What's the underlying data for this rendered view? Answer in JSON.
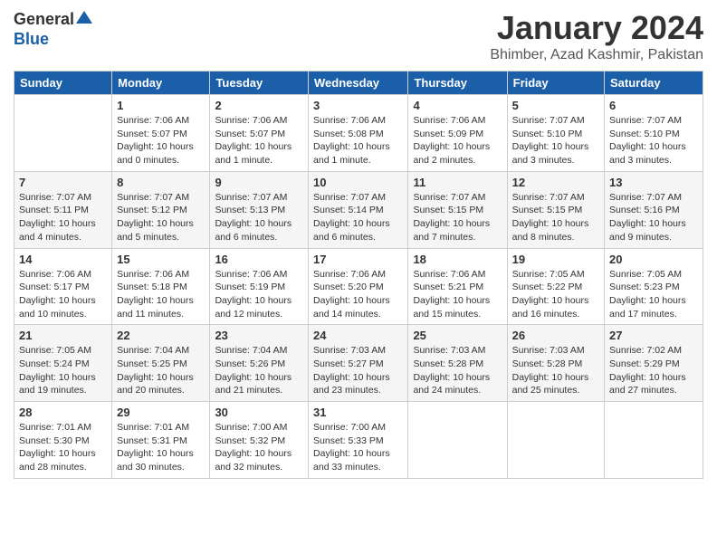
{
  "logo": {
    "general": "General",
    "blue": "Blue"
  },
  "header": {
    "month": "January 2024",
    "location": "Bhimber, Azad Kashmir, Pakistan"
  },
  "weekdays": [
    "Sunday",
    "Monday",
    "Tuesday",
    "Wednesday",
    "Thursday",
    "Friday",
    "Saturday"
  ],
  "weeks": [
    [
      {
        "day": "",
        "sunrise": "",
        "sunset": "",
        "daylight": ""
      },
      {
        "day": "1",
        "sunrise": "Sunrise: 7:06 AM",
        "sunset": "Sunset: 5:07 PM",
        "daylight": "Daylight: 10 hours and 0 minutes."
      },
      {
        "day": "2",
        "sunrise": "Sunrise: 7:06 AM",
        "sunset": "Sunset: 5:07 PM",
        "daylight": "Daylight: 10 hours and 1 minute."
      },
      {
        "day": "3",
        "sunrise": "Sunrise: 7:06 AM",
        "sunset": "Sunset: 5:08 PM",
        "daylight": "Daylight: 10 hours and 1 minute."
      },
      {
        "day": "4",
        "sunrise": "Sunrise: 7:06 AM",
        "sunset": "Sunset: 5:09 PM",
        "daylight": "Daylight: 10 hours and 2 minutes."
      },
      {
        "day": "5",
        "sunrise": "Sunrise: 7:07 AM",
        "sunset": "Sunset: 5:10 PM",
        "daylight": "Daylight: 10 hours and 3 minutes."
      },
      {
        "day": "6",
        "sunrise": "Sunrise: 7:07 AM",
        "sunset": "Sunset: 5:10 PM",
        "daylight": "Daylight: 10 hours and 3 minutes."
      }
    ],
    [
      {
        "day": "7",
        "sunrise": "Sunrise: 7:07 AM",
        "sunset": "Sunset: 5:11 PM",
        "daylight": "Daylight: 10 hours and 4 minutes."
      },
      {
        "day": "8",
        "sunrise": "Sunrise: 7:07 AM",
        "sunset": "Sunset: 5:12 PM",
        "daylight": "Daylight: 10 hours and 5 minutes."
      },
      {
        "day": "9",
        "sunrise": "Sunrise: 7:07 AM",
        "sunset": "Sunset: 5:13 PM",
        "daylight": "Daylight: 10 hours and 6 minutes."
      },
      {
        "day": "10",
        "sunrise": "Sunrise: 7:07 AM",
        "sunset": "Sunset: 5:14 PM",
        "daylight": "Daylight: 10 hours and 6 minutes."
      },
      {
        "day": "11",
        "sunrise": "Sunrise: 7:07 AM",
        "sunset": "Sunset: 5:15 PM",
        "daylight": "Daylight: 10 hours and 7 minutes."
      },
      {
        "day": "12",
        "sunrise": "Sunrise: 7:07 AM",
        "sunset": "Sunset: 5:15 PM",
        "daylight": "Daylight: 10 hours and 8 minutes."
      },
      {
        "day": "13",
        "sunrise": "Sunrise: 7:07 AM",
        "sunset": "Sunset: 5:16 PM",
        "daylight": "Daylight: 10 hours and 9 minutes."
      }
    ],
    [
      {
        "day": "14",
        "sunrise": "Sunrise: 7:06 AM",
        "sunset": "Sunset: 5:17 PM",
        "daylight": "Daylight: 10 hours and 10 minutes."
      },
      {
        "day": "15",
        "sunrise": "Sunrise: 7:06 AM",
        "sunset": "Sunset: 5:18 PM",
        "daylight": "Daylight: 10 hours and 11 minutes."
      },
      {
        "day": "16",
        "sunrise": "Sunrise: 7:06 AM",
        "sunset": "Sunset: 5:19 PM",
        "daylight": "Daylight: 10 hours and 12 minutes."
      },
      {
        "day": "17",
        "sunrise": "Sunrise: 7:06 AM",
        "sunset": "Sunset: 5:20 PM",
        "daylight": "Daylight: 10 hours and 14 minutes."
      },
      {
        "day": "18",
        "sunrise": "Sunrise: 7:06 AM",
        "sunset": "Sunset: 5:21 PM",
        "daylight": "Daylight: 10 hours and 15 minutes."
      },
      {
        "day": "19",
        "sunrise": "Sunrise: 7:05 AM",
        "sunset": "Sunset: 5:22 PM",
        "daylight": "Daylight: 10 hours and 16 minutes."
      },
      {
        "day": "20",
        "sunrise": "Sunrise: 7:05 AM",
        "sunset": "Sunset: 5:23 PM",
        "daylight": "Daylight: 10 hours and 17 minutes."
      }
    ],
    [
      {
        "day": "21",
        "sunrise": "Sunrise: 7:05 AM",
        "sunset": "Sunset: 5:24 PM",
        "daylight": "Daylight: 10 hours and 19 minutes."
      },
      {
        "day": "22",
        "sunrise": "Sunrise: 7:04 AM",
        "sunset": "Sunset: 5:25 PM",
        "daylight": "Daylight: 10 hours and 20 minutes."
      },
      {
        "day": "23",
        "sunrise": "Sunrise: 7:04 AM",
        "sunset": "Sunset: 5:26 PM",
        "daylight": "Daylight: 10 hours and 21 minutes."
      },
      {
        "day": "24",
        "sunrise": "Sunrise: 7:03 AM",
        "sunset": "Sunset: 5:27 PM",
        "daylight": "Daylight: 10 hours and 23 minutes."
      },
      {
        "day": "25",
        "sunrise": "Sunrise: 7:03 AM",
        "sunset": "Sunset: 5:28 PM",
        "daylight": "Daylight: 10 hours and 24 minutes."
      },
      {
        "day": "26",
        "sunrise": "Sunrise: 7:03 AM",
        "sunset": "Sunset: 5:28 PM",
        "daylight": "Daylight: 10 hours and 25 minutes."
      },
      {
        "day": "27",
        "sunrise": "Sunrise: 7:02 AM",
        "sunset": "Sunset: 5:29 PM",
        "daylight": "Daylight: 10 hours and 27 minutes."
      }
    ],
    [
      {
        "day": "28",
        "sunrise": "Sunrise: 7:01 AM",
        "sunset": "Sunset: 5:30 PM",
        "daylight": "Daylight: 10 hours and 28 minutes."
      },
      {
        "day": "29",
        "sunrise": "Sunrise: 7:01 AM",
        "sunset": "Sunset: 5:31 PM",
        "daylight": "Daylight: 10 hours and 30 minutes."
      },
      {
        "day": "30",
        "sunrise": "Sunrise: 7:00 AM",
        "sunset": "Sunset: 5:32 PM",
        "daylight": "Daylight: 10 hours and 32 minutes."
      },
      {
        "day": "31",
        "sunrise": "Sunrise: 7:00 AM",
        "sunset": "Sunset: 5:33 PM",
        "daylight": "Daylight: 10 hours and 33 minutes."
      },
      {
        "day": "",
        "sunrise": "",
        "sunset": "",
        "daylight": ""
      },
      {
        "day": "",
        "sunrise": "",
        "sunset": "",
        "daylight": ""
      },
      {
        "day": "",
        "sunrise": "",
        "sunset": "",
        "daylight": ""
      }
    ]
  ]
}
